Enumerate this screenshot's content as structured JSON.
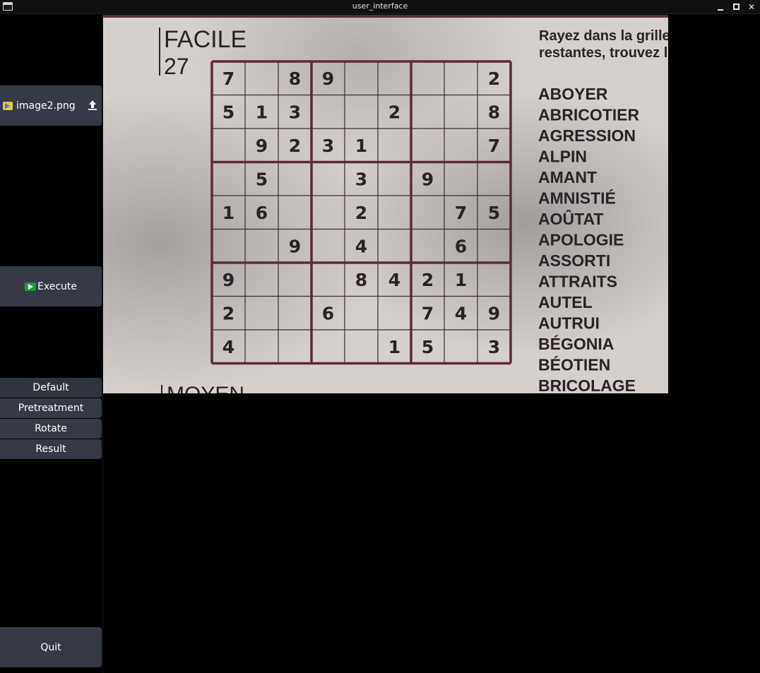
{
  "window": {
    "title": "user_interface"
  },
  "sidebar": {
    "file_button": {
      "label": "image2.png",
      "icon": "image-file-icon",
      "action_icon": "upload-icon"
    },
    "execute_button": {
      "label": "Execute",
      "icon": "play-icon"
    },
    "modes": [
      {
        "label": "Default",
        "active": true
      },
      {
        "label": "Pretreatment",
        "active": false
      },
      {
        "label": "Rotate",
        "active": false
      },
      {
        "label": "Result",
        "active": false
      }
    ],
    "quit_button": {
      "label": "Quit"
    }
  },
  "image": {
    "difficulty": "FACILE",
    "number": "27",
    "next_difficulty": "MOYEN",
    "instruction_line1": "Rayez dans la grille",
    "instruction_line2": "restantes, trouvez l",
    "words": [
      "ABOYER",
      "ABRICOTIER",
      "AGRESSION",
      "ALPIN",
      "AMANT",
      "AMNISTIÉ",
      "AOÛTAT",
      "APOLOGIE",
      "ASSORTI",
      "ATTRAITS",
      "AUTEL",
      "AUTRUI",
      "BÉGONIA",
      "BÉOTIEN",
      "BRICOLAGE"
    ],
    "grid": [
      [
        "7",
        "",
        "8",
        "9",
        "",
        "",
        "",
        "",
        "2"
      ],
      [
        "5",
        "1",
        "3",
        "",
        "",
        "2",
        "",
        "",
        "8"
      ],
      [
        "",
        "9",
        "2",
        "3",
        "1",
        "",
        "",
        "",
        "7"
      ],
      [
        "",
        "5",
        "",
        "",
        "3",
        "",
        "9",
        "",
        ""
      ],
      [
        "1",
        "6",
        "",
        "",
        "2",
        "",
        "",
        "7",
        "5"
      ],
      [
        "",
        "",
        "9",
        "",
        "4",
        "",
        "",
        "6",
        ""
      ],
      [
        "9",
        "",
        "",
        "",
        "8",
        "4",
        "2",
        "1",
        ""
      ],
      [
        "2",
        "",
        "",
        "6",
        "",
        "",
        "7",
        "4",
        "9"
      ],
      [
        "4",
        "",
        "",
        "",
        "",
        "1",
        "5",
        "",
        "3"
      ]
    ]
  },
  "colors": {
    "button_bg": "#353a46",
    "grid_line": "#5a2a3c",
    "paper": "#d8d2cf"
  }
}
